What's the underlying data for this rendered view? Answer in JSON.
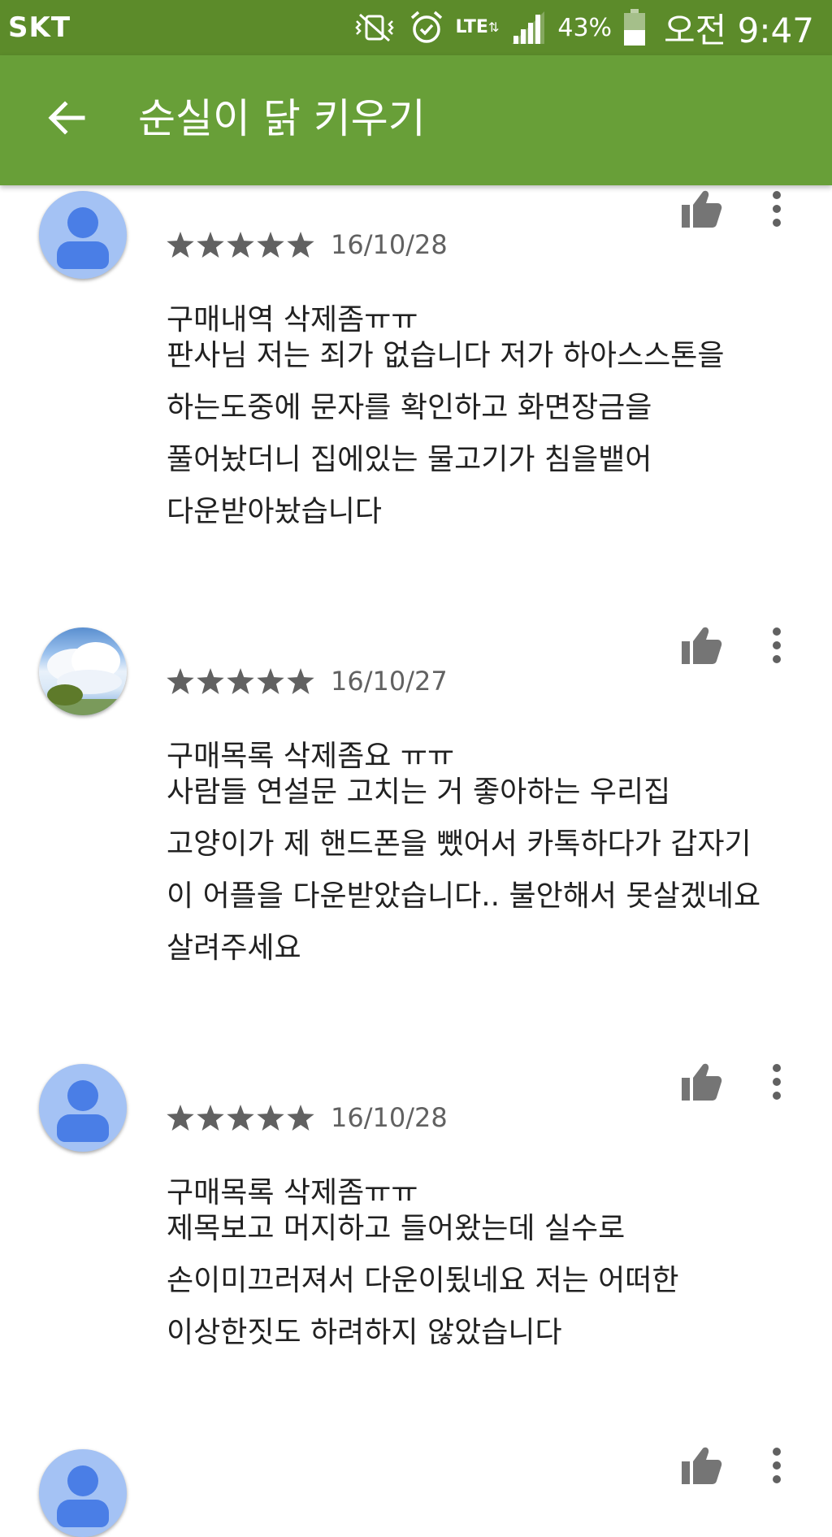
{
  "status_bar": {
    "carrier": "SKT",
    "network": "LTE",
    "battery": "43%",
    "time": "오전 9:47",
    "icons": [
      "vibrate-off-icon",
      "alarm-icon",
      "lte-icon",
      "signal-icon",
      "battery-icon"
    ]
  },
  "app_bar": {
    "title": "순실이 닭 키우기",
    "back_icon": "back-arrow-icon",
    "background": "#689f38"
  },
  "reviews": [
    {
      "avatar": "default",
      "rating": 5,
      "date": "16/10/28",
      "title": "구매내역 삭제좀ㅠㅠ",
      "lines": [
        "판사님 저는 죄가 없습니다 저가 하아스스톤을",
        "하는도중에 문자를 확인하고 화면장금을",
        "풀어놨더니 집에있는 물고기가 침을뱉어",
        "다운받아놨습니다"
      ]
    },
    {
      "avatar": "photo",
      "rating": 5,
      "date": "16/10/27",
      "title": "구매목록 삭제좀요 ㅠㅠ",
      "lines": [
        "사람들 연설문 고치는 거 좋아하는 우리집",
        "고양이가 제 핸드폰을 뺐어서 카톡하다가 갑자기",
        "이 어플을 다운받았습니다.. 불안해서 못살겠네요",
        "살려주세요"
      ]
    },
    {
      "avatar": "default",
      "rating": 5,
      "date": "16/10/28",
      "title": "구매목록 삭제좀ㅠㅠ",
      "lines": [
        "제목보고 머지하고 들어왔는데 실수로",
        "손이미끄러져서 다운이됬네요 저는 어떠한",
        "이상한짓도 하려하지 않았습니다"
      ]
    }
  ]
}
